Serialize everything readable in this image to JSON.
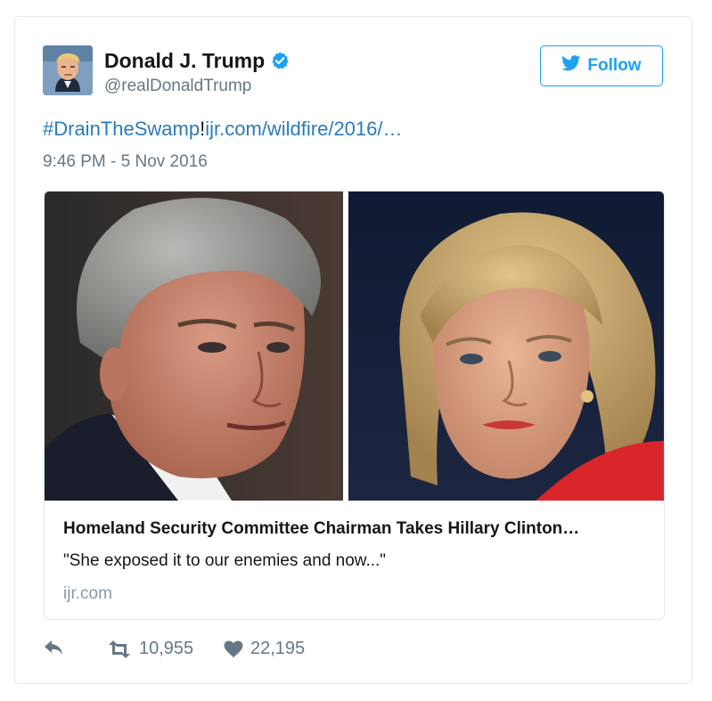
{
  "tweet": {
    "author_name": "Donald J. Trump",
    "author_handle": "@realDonaldTrump",
    "verified": true,
    "follow_label": "Follow",
    "text_hashtag": "#DrainTheSwamp",
    "text_separator": "!",
    "text_link": "ijr.com/wildfire/2016/…",
    "timestamp": "9:46 PM - 5 Nov 2016",
    "card": {
      "title": "Homeland Security Committee Chairman Takes Hillary Clinton…",
      "description": "\"She exposed it to our enemies and now...\"",
      "domain": "ijr.com"
    },
    "stats": {
      "retweets": "10,955",
      "likes": "22,195"
    }
  },
  "colors": {
    "accent": "#1da1f2",
    "link": "#2b7bb9",
    "secondary_text": "#657786",
    "border": "#e1e8ed"
  },
  "icons": [
    "verified-badge-icon",
    "twitter-bird-icon",
    "reply-icon",
    "retweet-icon",
    "heart-icon"
  ]
}
